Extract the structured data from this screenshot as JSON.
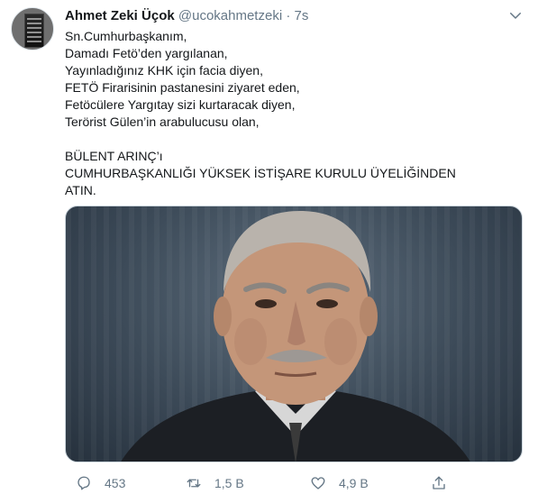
{
  "tweet": {
    "author_name": "Ahmet Zeki Üçok",
    "handle": "@ucokahmetzeki",
    "separator": "·",
    "time": "7s",
    "lines": [
      "Sn.Cumhurbaşkanım,",
      "Damadı Fetö’den yargılanan,",
      "Yayınladığınız KHK için facia diyen,",
      "FETÖ Firarisinin pastanesini ziyaret eden,",
      "Fetöcülere Yargıtay sizi kurtaracak diyen,",
      "Terörist Gülen’in arabulucusu olan,"
    ],
    "lines2": [
      "BÜLENT ARINÇ’ı",
      "CUMHURBAŞKANLIĞI YÜKSEK İSTİŞARE KURULU ÜYELİĞİNDEN",
      "ATIN."
    ],
    "media_description": "photo-portrait",
    "stats": {
      "replies": "453",
      "retweets": "1,5 B",
      "likes": "4,9 B"
    }
  },
  "icons": {
    "reply": "reply-icon",
    "retweet": "retweet-icon",
    "like": "heart-icon",
    "share": "share-icon",
    "menu": "chevron-down-icon"
  },
  "colors": {
    "text": "#14171a",
    "secondary": "#657786",
    "border": "#ccd6dd"
  }
}
